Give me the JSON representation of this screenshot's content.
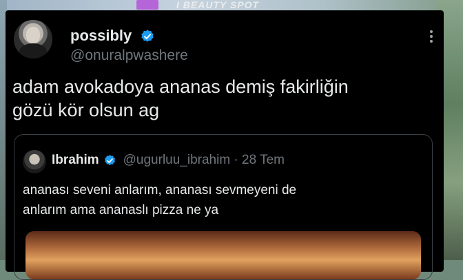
{
  "background": {
    "banner_text": "I BEAUTY SPOT"
  },
  "tweet": {
    "display_name": "possibly",
    "handle": "@onuralpwashere",
    "text_line1": "adam avokadoya ananas demiş fakirliğin",
    "text_line2": "gözü kör olsun ag",
    "verified": true
  },
  "quoted_tweet": {
    "display_name": "Ibrahim",
    "handle": "@ugurluu_ibrahim · 28 Tem",
    "text_line1": "ananası seveni anlarım, ananası sevmeyeni de",
    "text_line2": "anlarım ama ananaslı pizza ne ya",
    "verified": true
  },
  "colors": {
    "card": "#000000",
    "text": "#e7e9ea",
    "muted": "#71767b",
    "verified": "#1d9bf0"
  },
  "icons": [
    "verified-badge-icon",
    "more-options-icon"
  ]
}
